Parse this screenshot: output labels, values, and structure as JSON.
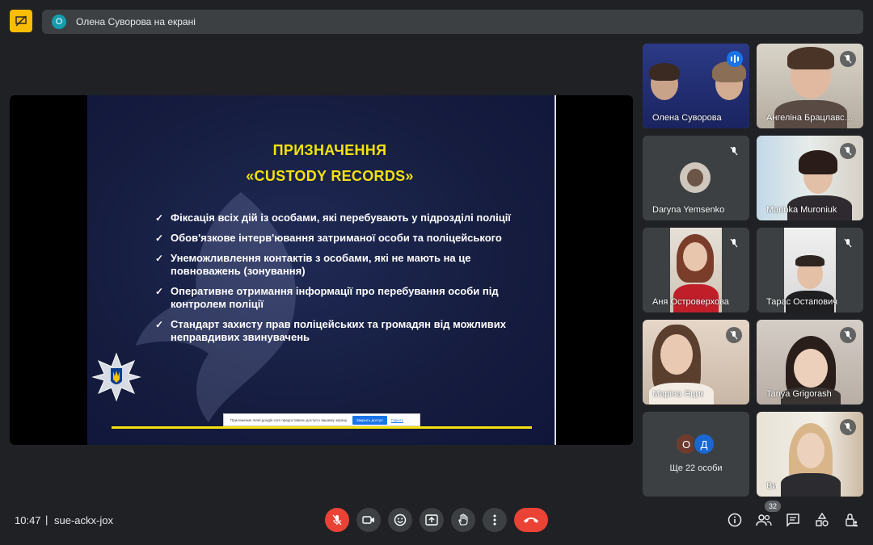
{
  "top_bar": {
    "presenter_initial": "О",
    "presenter_text": "Олена Суворова на екрані"
  },
  "slide": {
    "title_line1": "ПРИЗНАЧЕННЯ",
    "title_line2": "«CUSTODY RECORDS»",
    "bullets": [
      "Фіксація всіх дій із особами, які перебувають у підрозділі поліції",
      "Обов'язкове інтерв'ювання затриманої особи та поліцейського",
      "Унеможливлення контактів з особами, які не мають на це повноважень (зонування)",
      "Оперативне отримання інформації про перебування особи під контролем поліції",
      "Стандарт захисту прав поліцейських та громадян від можливих неправдивих звинувачень"
    ],
    "check_mark": "✓",
    "share_notice": {
      "text": "Приложение meet.google.com предоставлен доступ к вашему экрану.",
      "stop_button": "Закрыть доступ",
      "hide_link": "Скрыть"
    },
    "colors": {
      "title": "#f4e10e",
      "background": "#151c3e"
    }
  },
  "participants": [
    {
      "name": "Олена Суворова",
      "speaking": true
    },
    {
      "name": "Ангеліна Брацлавська",
      "muted": true
    },
    {
      "name": "Daryna Yemsenko",
      "muted": true
    },
    {
      "name": "Marinka Muroniuk",
      "muted": true
    },
    {
      "name": "Аня Островерхова",
      "muted": true
    },
    {
      "name": "Тарас Остапович",
      "muted": true
    },
    {
      "name": "Маріна Яцик",
      "muted": true
    },
    {
      "name": "Tanya Grigorash",
      "muted": true
    },
    {
      "name": "Ви",
      "muted": true
    }
  ],
  "more_tile": {
    "avatars": [
      {
        "initial": "О",
        "color": "#c5221f"
      },
      {
        "initial": "Д",
        "color": "#1967d2"
      }
    ],
    "label": "Ще 22 особи"
  },
  "bottom_bar": {
    "time": "10:47",
    "separator": "|",
    "meeting_code": "sue-ackx-jox",
    "people_count": "32",
    "controls": [
      "mic-off",
      "camera",
      "emoji",
      "present",
      "raise-hand",
      "more-options",
      "end-call"
    ],
    "right_icons": [
      "info",
      "people",
      "chat",
      "activities",
      "host-controls"
    ]
  }
}
